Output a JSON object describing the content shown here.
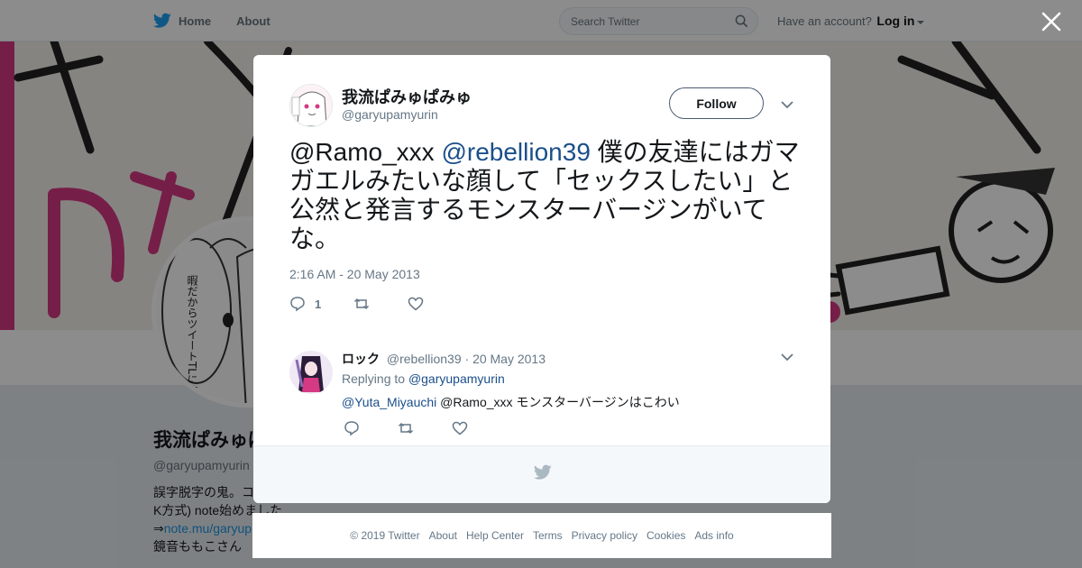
{
  "topbar": {
    "home_label": "Home",
    "about_label": "About",
    "search_placeholder": "Search Twitter",
    "account_prompt": "Have an account?",
    "login_label": "Log in"
  },
  "profile": {
    "name": "我流ぱみゅぱみゅ",
    "handle": "@garyupamyurin",
    "bio_line1": "誤字脱字の鬼。コ",
    "bio_line2": "K方式) note始めました",
    "bio_link": "note.mu/garyup",
    "bio_link_prefix": "⇒",
    "bio_line4": "鏡音ももこさん",
    "avatar_caption": "暇だからツイートTLに流すでも不穏か"
  },
  "tweet": {
    "author_name": "我流ぱみゅぱみゅ",
    "author_handle": "@garyupamyurin",
    "follow_label": "Follow",
    "mention1": "@Ramo_xxx",
    "mention2": "@rebellion39",
    "body": "僕の友達にはガマガエルみたいな顔して「セックスしたい」と公然と発言するモンスターバージンがいてな。",
    "timestamp": "2:16 AM - 20 May 2013",
    "reply_count": "1"
  },
  "reply": {
    "author_name": "ロック",
    "author_handle": "@rebellion39",
    "dot": "·",
    "date": "20 May 2013",
    "replying_label": "Replying to",
    "replying_handle": "@garyupamyurin",
    "mention1": "@Yuta_Miyauchi",
    "mention2": "@Ramo_xxx",
    "body": "モンスターバージンはこわい"
  },
  "footer": {
    "copyright": "© 2019 Twitter",
    "links": [
      "About",
      "Help Center",
      "Terms",
      "Privacy policy",
      "Cookies",
      "Ads info"
    ]
  },
  "colors": {
    "accent": "#1da1f2",
    "link": "#1b4f8a",
    "banner_pink": "#d63a84"
  }
}
